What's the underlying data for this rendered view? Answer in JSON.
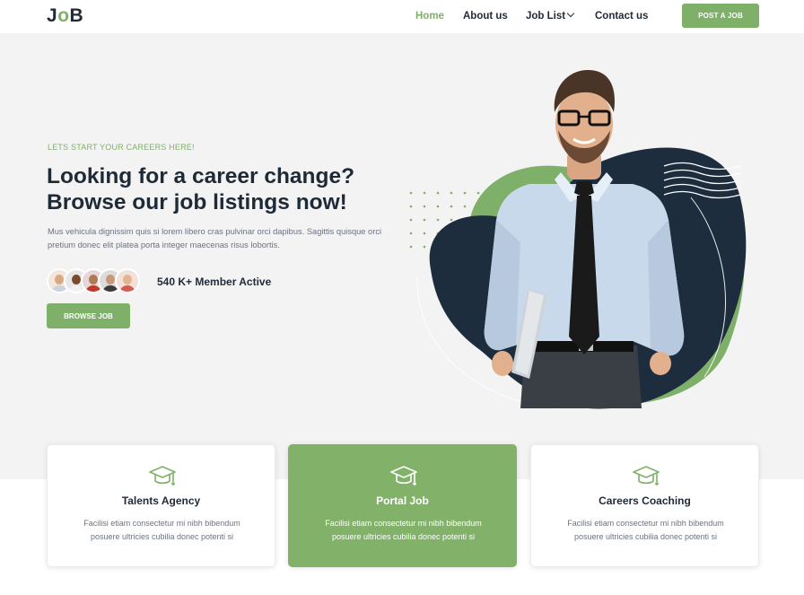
{
  "header": {
    "logo": {
      "j": "J",
      "o": "o",
      "b": "B"
    },
    "nav": {
      "home": "Home",
      "about": "About us",
      "job_list": "Job List",
      "contact": "Contact us"
    },
    "post_job_label": "POST A JOB"
  },
  "hero": {
    "eyebrow": "LETS START YOUR CAREERS HERE!",
    "headline_line1": "Looking for a career change?",
    "headline_line2": "Browse our job listings now!",
    "description": "Mus vehicula dignissim quis si lorem libero cras pulvinar orci dapibus. Sagittis quisque orci pretium donec elit platea porta integer maecenas risus lobortis.",
    "members_text": "540 K+ Member Active",
    "browse_label": "BROWSE JOB"
  },
  "cards": [
    {
      "title": "Talents Agency",
      "text": "Facilisi etiam consectetur mi nibh bibendum posuere ultricies cubilia donec potenti si",
      "icon": "graduation-cap-icon"
    },
    {
      "title": "Portal Job",
      "text": "Facilisi etiam consectetur mi nibh bibendum posuere ultricies cubilia donec potenti si",
      "icon": "graduation-cap-icon"
    },
    {
      "title": "Careers Coaching",
      "text": "Facilisi etiam consectetur mi nibh bibendum posuere ultricies cubilia donec potenti si",
      "icon": "graduation-cap-icon"
    }
  ],
  "colors": {
    "accent": "#7fb069",
    "dark": "#1f2a37",
    "hero_bg": "#f3f3f3",
    "blob_navy": "#1e2d3d"
  }
}
